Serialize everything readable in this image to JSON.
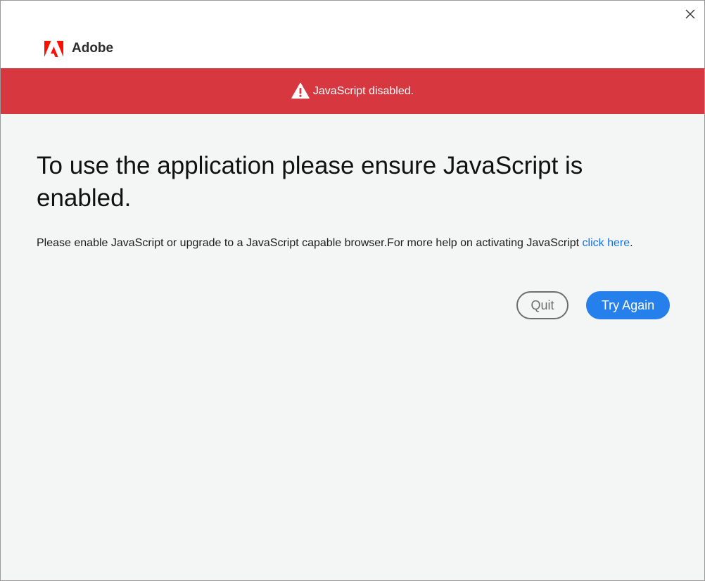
{
  "window": {
    "close_label": "Close"
  },
  "brand": {
    "name": "Adobe",
    "logo_color": "#fa0f00"
  },
  "banner": {
    "text": "JavaScript disabled.",
    "color": "#d7373f",
    "icon": "warning-icon"
  },
  "main": {
    "headline": "To use the application please ensure JavaScript is enabled.",
    "body_text": "Please enable JavaScript or upgrade to a JavaScript capable browser.For more help on activating JavaScript ",
    "help_link": "click here",
    "help_link_suffix": ".",
    "link_color": "#1473e6"
  },
  "actions": {
    "quit_label": "Quit",
    "try_again_label": "Try Again",
    "primary_color": "#2680eb"
  }
}
